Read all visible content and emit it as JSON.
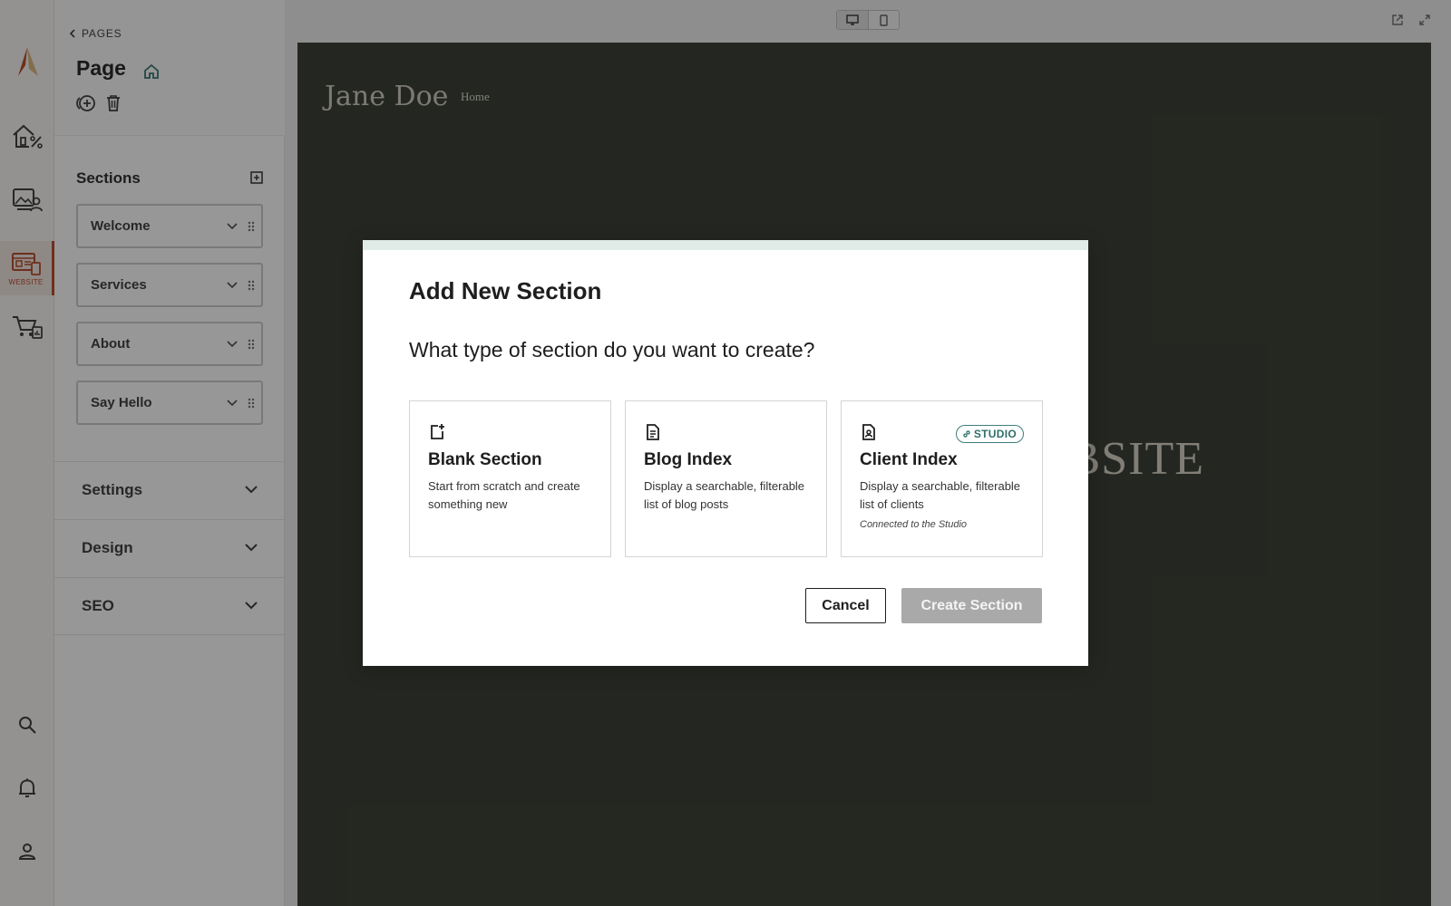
{
  "rail": {
    "items": [
      {
        "icon": "brand-logo-icon"
      },
      {
        "icon": "home-percent-icon"
      },
      {
        "icon": "gallery-user-icon"
      },
      {
        "icon": "website-icon",
        "caption": "WEBSITE",
        "active": true
      },
      {
        "icon": "cart-chart-icon"
      },
      {
        "icon": "search-icon"
      },
      {
        "icon": "bell-icon"
      },
      {
        "icon": "user-icon"
      }
    ],
    "accent": "#b5431f"
  },
  "sidebar": {
    "back_label": "PAGES",
    "page_title": "Page",
    "sections_title": "Sections",
    "sections": [
      {
        "label": "Welcome"
      },
      {
        "label": "Services"
      },
      {
        "label": "About"
      },
      {
        "label": "Say Hello"
      }
    ],
    "accordions": [
      {
        "label": "Settings"
      },
      {
        "label": "Design"
      },
      {
        "label": "SEO"
      }
    ]
  },
  "preview": {
    "site_name": "Jane Doe",
    "nav_home": "Home",
    "hero_partial": "EBSITE",
    "background": "#2e3328"
  },
  "modal": {
    "title": "Add New Section",
    "question": "What type of section do you want to create?",
    "options": [
      {
        "title": "Blank Section",
        "description": "Start from scratch and create something new",
        "icon": "new-page-icon"
      },
      {
        "title": "Blog Index",
        "description": "Display a searchable, filterable list of blog posts",
        "icon": "document-icon"
      },
      {
        "title": "Client Index",
        "description": "Display a searchable, filterable list of clients",
        "note": "Connected to the Studio",
        "badge": "STUDIO",
        "icon": "client-document-icon"
      }
    ],
    "cancel_label": "Cancel",
    "create_label": "Create Section",
    "accent": "#2f6f6a"
  }
}
